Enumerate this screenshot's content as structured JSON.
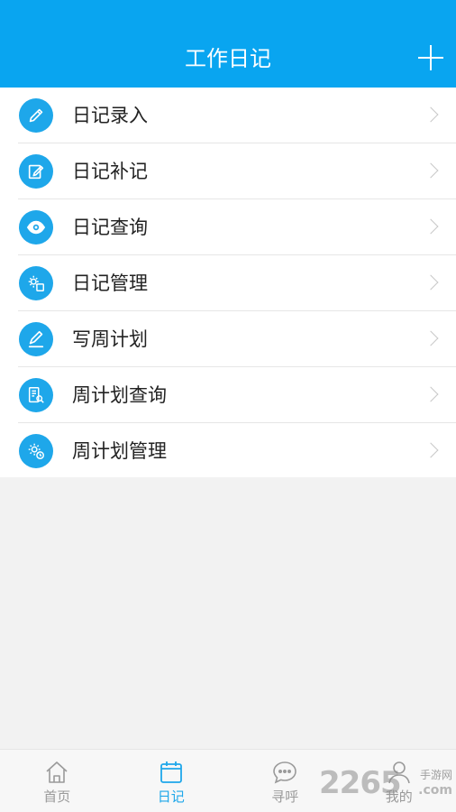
{
  "header": {
    "title": "工作日记",
    "add_icon": "plus-icon"
  },
  "menu": {
    "items": [
      {
        "label": "日记录入",
        "icon": "pencil-icon"
      },
      {
        "label": "日记补记",
        "icon": "edit-note-icon"
      },
      {
        "label": "日记查询",
        "icon": "eye-icon"
      },
      {
        "label": "日记管理",
        "icon": "gear-document-icon"
      },
      {
        "label": "写周计划",
        "icon": "pen-write-icon"
      },
      {
        "label": "周计划查询",
        "icon": "document-search-icon"
      },
      {
        "label": "周计划管理",
        "icon": "gear-clock-icon"
      }
    ]
  },
  "tabbar": {
    "tabs": [
      {
        "label": "首页",
        "icon": "home-icon",
        "active": false
      },
      {
        "label": "日记",
        "icon": "calendar-icon",
        "active": true
      },
      {
        "label": "寻呼",
        "icon": "chat-bubble-icon",
        "active": false
      },
      {
        "label": "我的",
        "icon": "person-icon",
        "active": false
      }
    ]
  },
  "watermark": {
    "number": "2265",
    "text_top": "手游网",
    "text_bottom": ".com"
  },
  "colors": {
    "header_bg": "#09a5f0",
    "icon_bg": "#1ea7ea",
    "active_tab": "#1ea7ea",
    "inactive_tab": "#9a9a9a"
  }
}
